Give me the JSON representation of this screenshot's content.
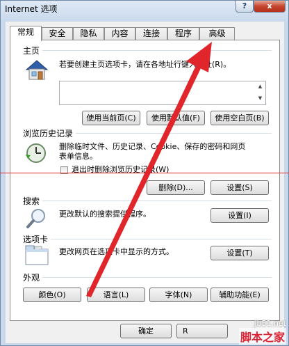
{
  "window": {
    "title": "Internet 选项",
    "help_label": "?",
    "close_label": "x"
  },
  "tabs": [
    {
      "label": "常规",
      "active": true
    },
    {
      "label": "安全"
    },
    {
      "label": "隐私"
    },
    {
      "label": "内容"
    },
    {
      "label": "连接"
    },
    {
      "label": "程序"
    },
    {
      "label": "高级"
    }
  ],
  "homepage": {
    "heading": "主页",
    "description": "若要创建主页选项卡，请在各地址行键入地址(R)。",
    "address_value": "",
    "btn_current": "使用当前页(C)",
    "btn_default": "使用默认值(F)",
    "btn_blank": "使用空白页(B)"
  },
  "history": {
    "heading": "浏览历史记录",
    "description_line1": "删除临时文件、历史记录、Cookie、保存的密码和网页",
    "description_line2": "表单信息。",
    "checkbox_label": "退出时删除浏览历史记录(W)",
    "btn_delete": "删除(D)...",
    "btn_settings": "设置(S)"
  },
  "search": {
    "heading": "搜索",
    "description": "更改默认的搜索提供程序。",
    "btn_settings": "设置(I)"
  },
  "tabs_section": {
    "heading": "选项卡",
    "description": "更改网页在选项卡中显示的方式。",
    "btn_settings": "设置(T)"
  },
  "appearance": {
    "heading": "外观",
    "btn_colors": "颜色(O)",
    "btn_languages": "语言(L)",
    "btn_fonts": "字体(N)",
    "btn_accessibility": "辅助功能(E)"
  },
  "footer": {
    "btn_ok": "确定",
    "btn_cancel_partial": "R"
  },
  "watermark": {
    "site": "jb51.net",
    "name": "脚本之家"
  },
  "colors": {
    "annotation": "#e0262b"
  }
}
